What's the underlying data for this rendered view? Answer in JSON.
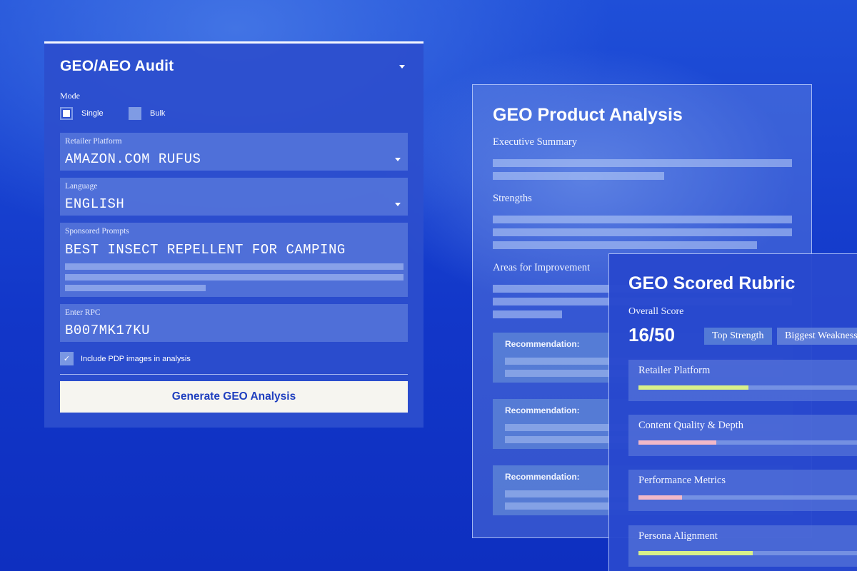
{
  "audit": {
    "title": "GEO/AEO Audit",
    "mode_label": "Mode",
    "mode_options": [
      "Single",
      "Bulk"
    ],
    "mode_selected": "Single",
    "retailer": {
      "label": "Retailer Platform",
      "value": "AMAZON.COM RUFUS"
    },
    "language": {
      "label": "Language",
      "value": "ENGLISH"
    },
    "prompts": {
      "label": "Sponsored Prompts",
      "value": "BEST INSECT REPELLENT FOR CAMPING"
    },
    "rpc": {
      "label": "Enter RPC",
      "value": "B007MK17KU"
    },
    "include_images": {
      "label": "Include PDP images in analysis",
      "checked": true
    },
    "generate_label": "Generate GEO Analysis"
  },
  "analysis": {
    "title": "GEO Product Analysis",
    "executive_summary": "Executive Summary",
    "strengths": "Strengths",
    "improvement": "Areas for Improvement",
    "recommendations": [
      "Recommendation:",
      "Recommendation:",
      "Recommendation:"
    ]
  },
  "rubric": {
    "title": "GEO Scored Rubric",
    "overall_label": "Overall Score",
    "overall_score": "16/50",
    "top_strength": "Top Strength",
    "biggest_weakness": "Biggest Weakness",
    "criteria": [
      {
        "label": "Retailer Platform",
        "score": 0.48,
        "color": "#d8f08a"
      },
      {
        "label": "Content Quality & Depth",
        "score": 0.34,
        "color": "#f2b8c8"
      },
      {
        "label": "Performance Metrics",
        "score": 0.19,
        "color": "#f2b8c8"
      },
      {
        "label": "Persona Alignment",
        "score": 0.5,
        "color": "#d8f08a"
      }
    ]
  }
}
